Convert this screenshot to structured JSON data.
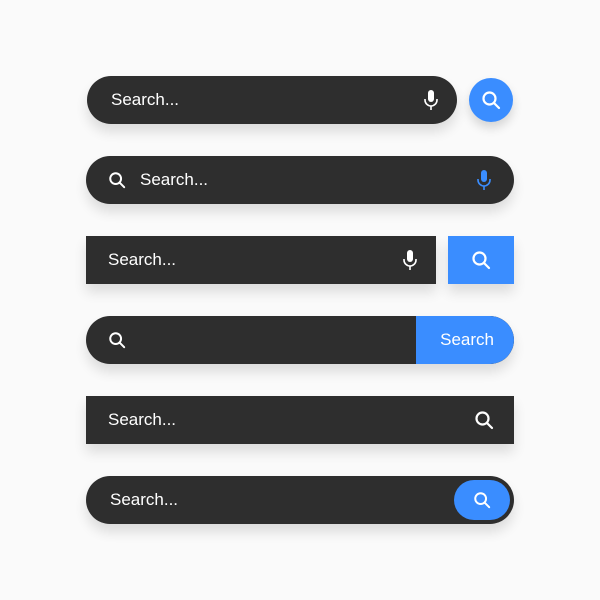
{
  "placeholder": "Search...",
  "button_label": "Search",
  "colors": {
    "bar_bg": "#2e2e2e",
    "accent": "#3a8dff",
    "text": "#ffffff"
  }
}
